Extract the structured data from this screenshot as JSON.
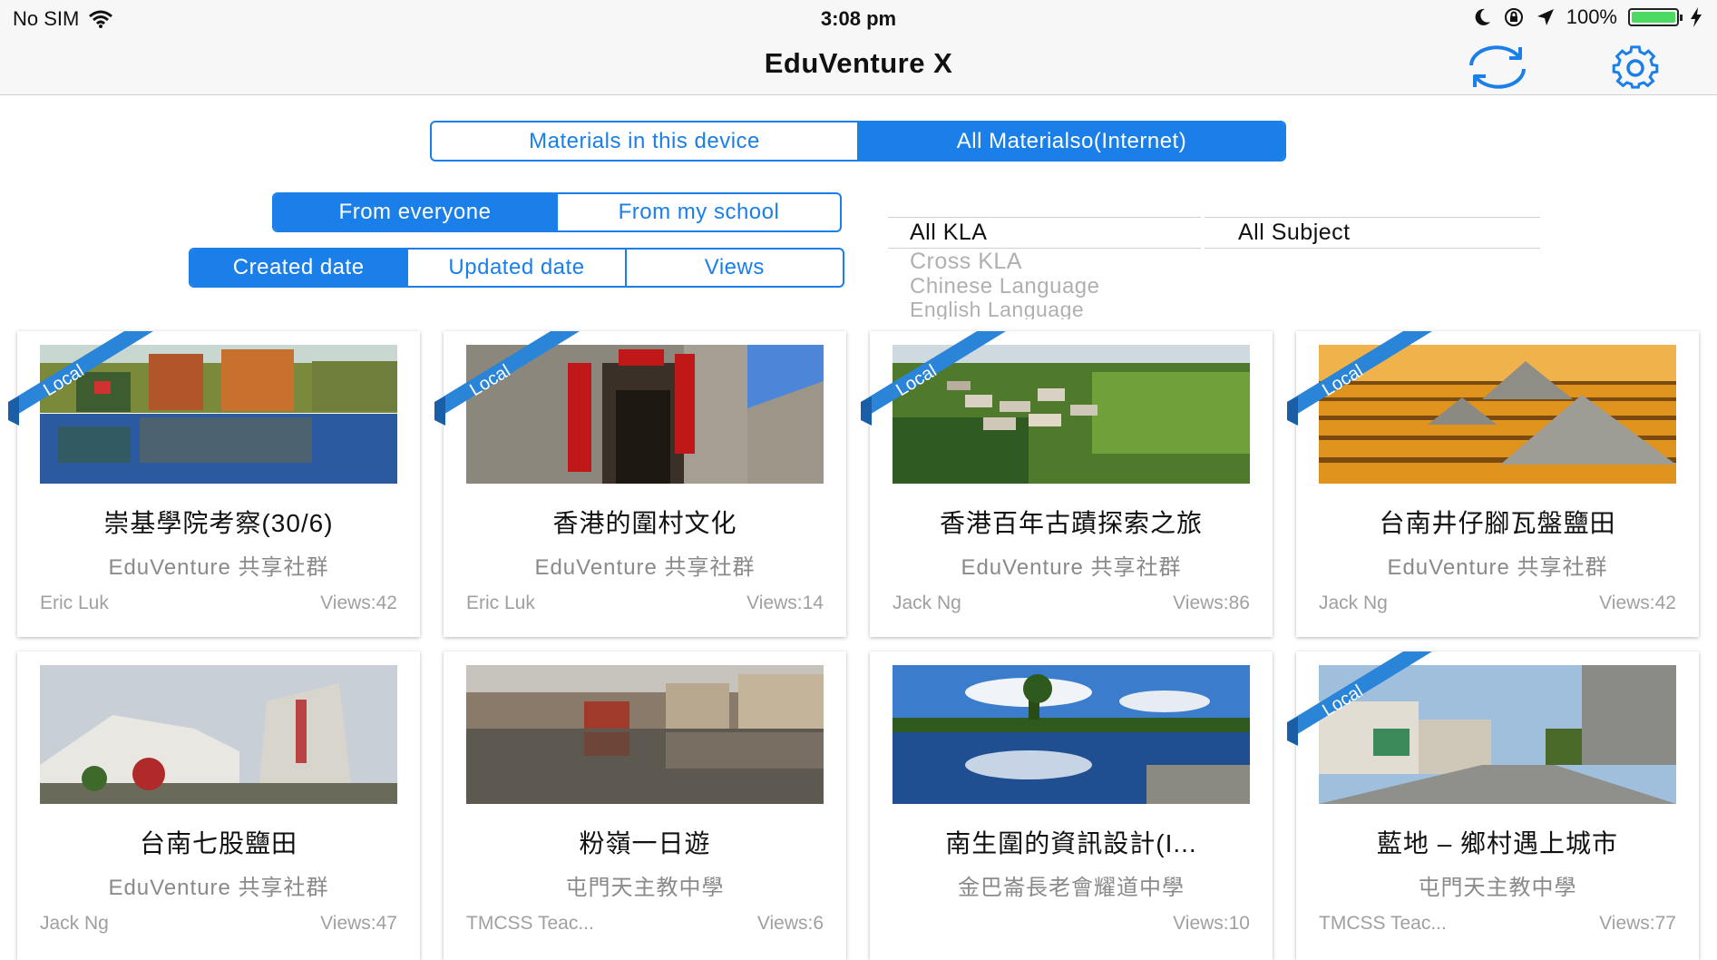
{
  "status_bar": {
    "carrier": "No SIM",
    "time": "3:08 pm",
    "battery": "100%",
    "battery_level": 1.0
  },
  "nav": {
    "title": "EduVenture X",
    "refresh_icon": "refresh-icon",
    "settings_icon": "gear-icon"
  },
  "source_tabs": {
    "options": [
      "Materials in this device",
      "All Materialso(Internet)"
    ],
    "selected": 1
  },
  "scope_tabs": {
    "options": [
      "From everyone",
      "From my school"
    ],
    "selected": 0
  },
  "sort_tabs": {
    "options": [
      "Created date",
      "Updated date",
      "Views"
    ],
    "selected": 0
  },
  "kla_picker": {
    "items": [
      "All KLA",
      "Cross KLA",
      "Chinese Language",
      "English Language"
    ],
    "selected": 0
  },
  "subject_picker": {
    "items": [
      "All Subject"
    ],
    "selected": 0
  },
  "local_label": "Local",
  "accent_color": "#1a7fe8",
  "cards": [
    {
      "title": "崇基學院考察(30/6)",
      "group": "EduVenture 共享社群",
      "author": "Eric Luk",
      "views": "Views:42",
      "local": true
    },
    {
      "title": "香港的圍村文化",
      "group": "EduVenture 共享社群",
      "author": "Eric Luk",
      "views": "Views:14",
      "local": true
    },
    {
      "title": "香港百年古蹟探索之旅",
      "group": "EduVenture 共享社群",
      "author": "Jack Ng",
      "views": "Views:86",
      "local": true
    },
    {
      "title": "台南井仔腳瓦盤鹽田",
      "group": "EduVenture 共享社群",
      "author": "Jack Ng",
      "views": "Views:42",
      "local": true
    },
    {
      "title": "台南七股鹽田",
      "group": "EduVenture 共享社群",
      "author": "Jack Ng",
      "views": "Views:47",
      "local": false
    },
    {
      "title": "粉嶺一日遊",
      "group": "屯門天主教中學",
      "author": "TMCSS Teac...",
      "views": "Views:6",
      "local": false
    },
    {
      "title": "南生圍的資訊設計(I...",
      "group": "金巴崙長老會耀道中學",
      "author": "",
      "views": "Views:10",
      "local": false
    },
    {
      "title": "藍地 – 鄉村遇上城市",
      "group": "屯門天主教中學",
      "author": "TMCSS Teac...",
      "views": "Views:77",
      "local": true
    }
  ]
}
